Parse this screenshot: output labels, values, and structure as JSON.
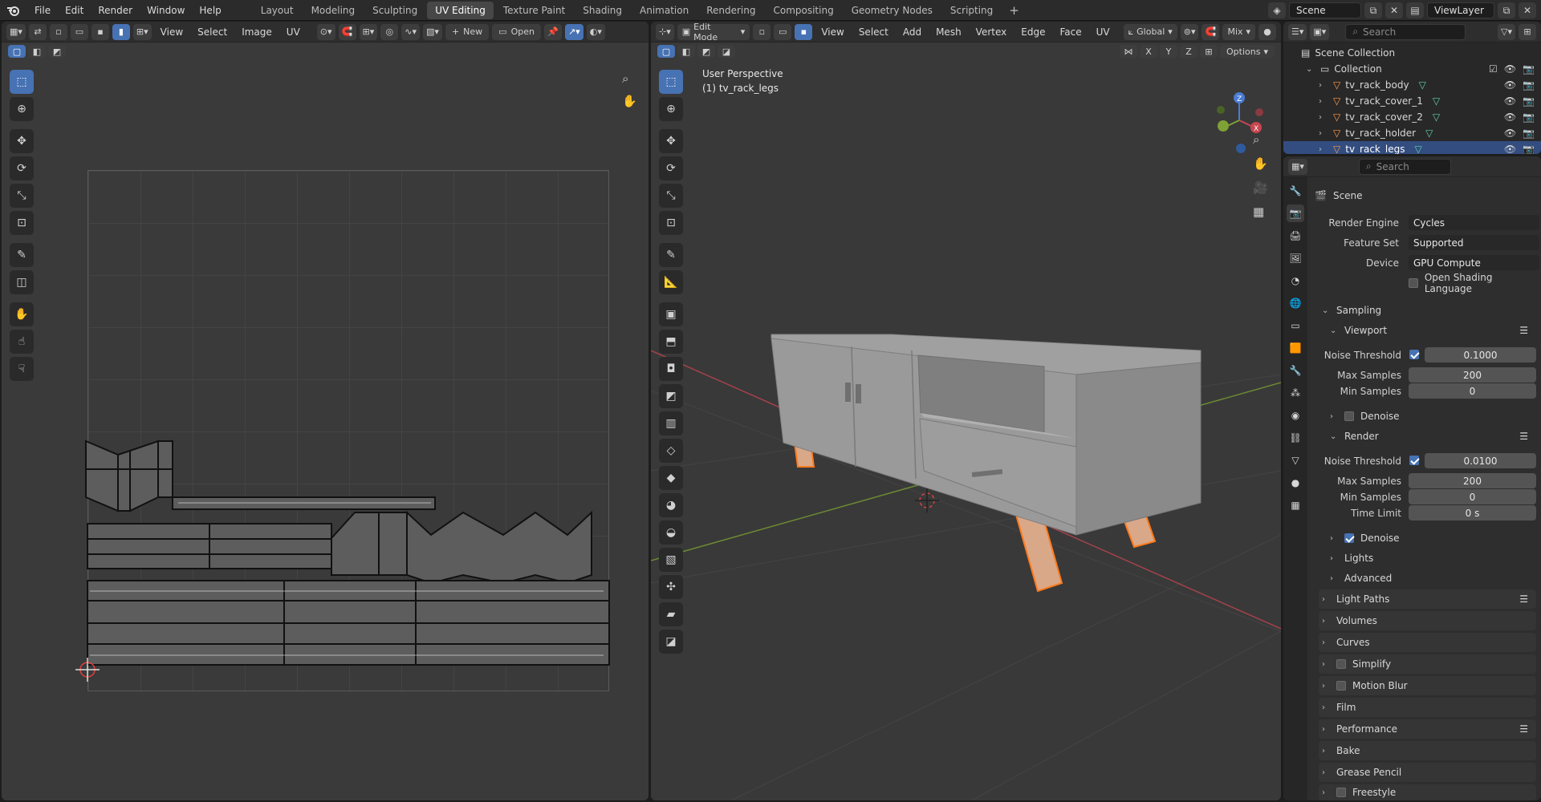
{
  "topbar": {
    "menus": [
      "File",
      "Edit",
      "Render",
      "Window",
      "Help"
    ],
    "workspaces": [
      "Layout",
      "Modeling",
      "Sculpting",
      "UV Editing",
      "Texture Paint",
      "Shading",
      "Animation",
      "Rendering",
      "Compositing",
      "Geometry Nodes",
      "Scripting"
    ],
    "active_workspace": "UV Editing",
    "scene_name": "Scene",
    "view_layer": "ViewLayer"
  },
  "uv_editor": {
    "menus": [
      "View",
      "Select",
      "Image",
      "UV"
    ],
    "new_label": "New",
    "open_label": "Open"
  },
  "viewport": {
    "mode": "Edit Mode",
    "menus": [
      "View",
      "Select",
      "Add",
      "Mesh",
      "Vertex",
      "Edge",
      "Face",
      "UV"
    ],
    "orientation": "Global",
    "blend": "Mix",
    "options_label": "Options",
    "axes": [
      "X",
      "Y",
      "Z"
    ],
    "perspective_label": "User Perspective",
    "object_label": "(1) tv_rack_legs"
  },
  "outliner": {
    "search_placeholder": "Search",
    "scene_collection": "Scene Collection",
    "collection": "Collection",
    "objects": [
      "tv_rack_body",
      "tv_rack_cover_1",
      "tv_rack_cover_2",
      "tv_rack_holder",
      "tv_rack_legs"
    ]
  },
  "properties": {
    "search_placeholder": "Search",
    "context": "Scene",
    "render_engine_label": "Render Engine",
    "render_engine": "Cycles",
    "feature_set_label": "Feature Set",
    "feature_set": "Supported",
    "device_label": "Device",
    "device": "GPU Compute",
    "osl_label": "Open Shading Language",
    "sampling": "Sampling",
    "viewport": "Viewport",
    "noise_threshold_label": "Noise Threshold",
    "viewport_noise_threshold": "0.1000",
    "max_samples_label": "Max Samples",
    "viewport_max_samples": "200",
    "min_samples_label": "Min Samples",
    "viewport_min_samples": "0",
    "denoise_label": "Denoise",
    "render": "Render",
    "render_noise_threshold": "0.0100",
    "render_max_samples": "200",
    "render_min_samples": "0",
    "time_limit_label": "Time Limit",
    "time_limit": "0 s",
    "lights": "Lights",
    "advanced": "Advanced",
    "panels": [
      "Light Paths",
      "Volumes",
      "Curves",
      "Simplify",
      "Motion Blur",
      "Film",
      "Performance",
      "Bake",
      "Grease Pencil",
      "Freestyle"
    ]
  },
  "colors": {
    "accent": "#4772b3",
    "selected_edge": "#ff7a1a",
    "x_axis": "#c0474d",
    "y_axis": "#7fa135"
  }
}
